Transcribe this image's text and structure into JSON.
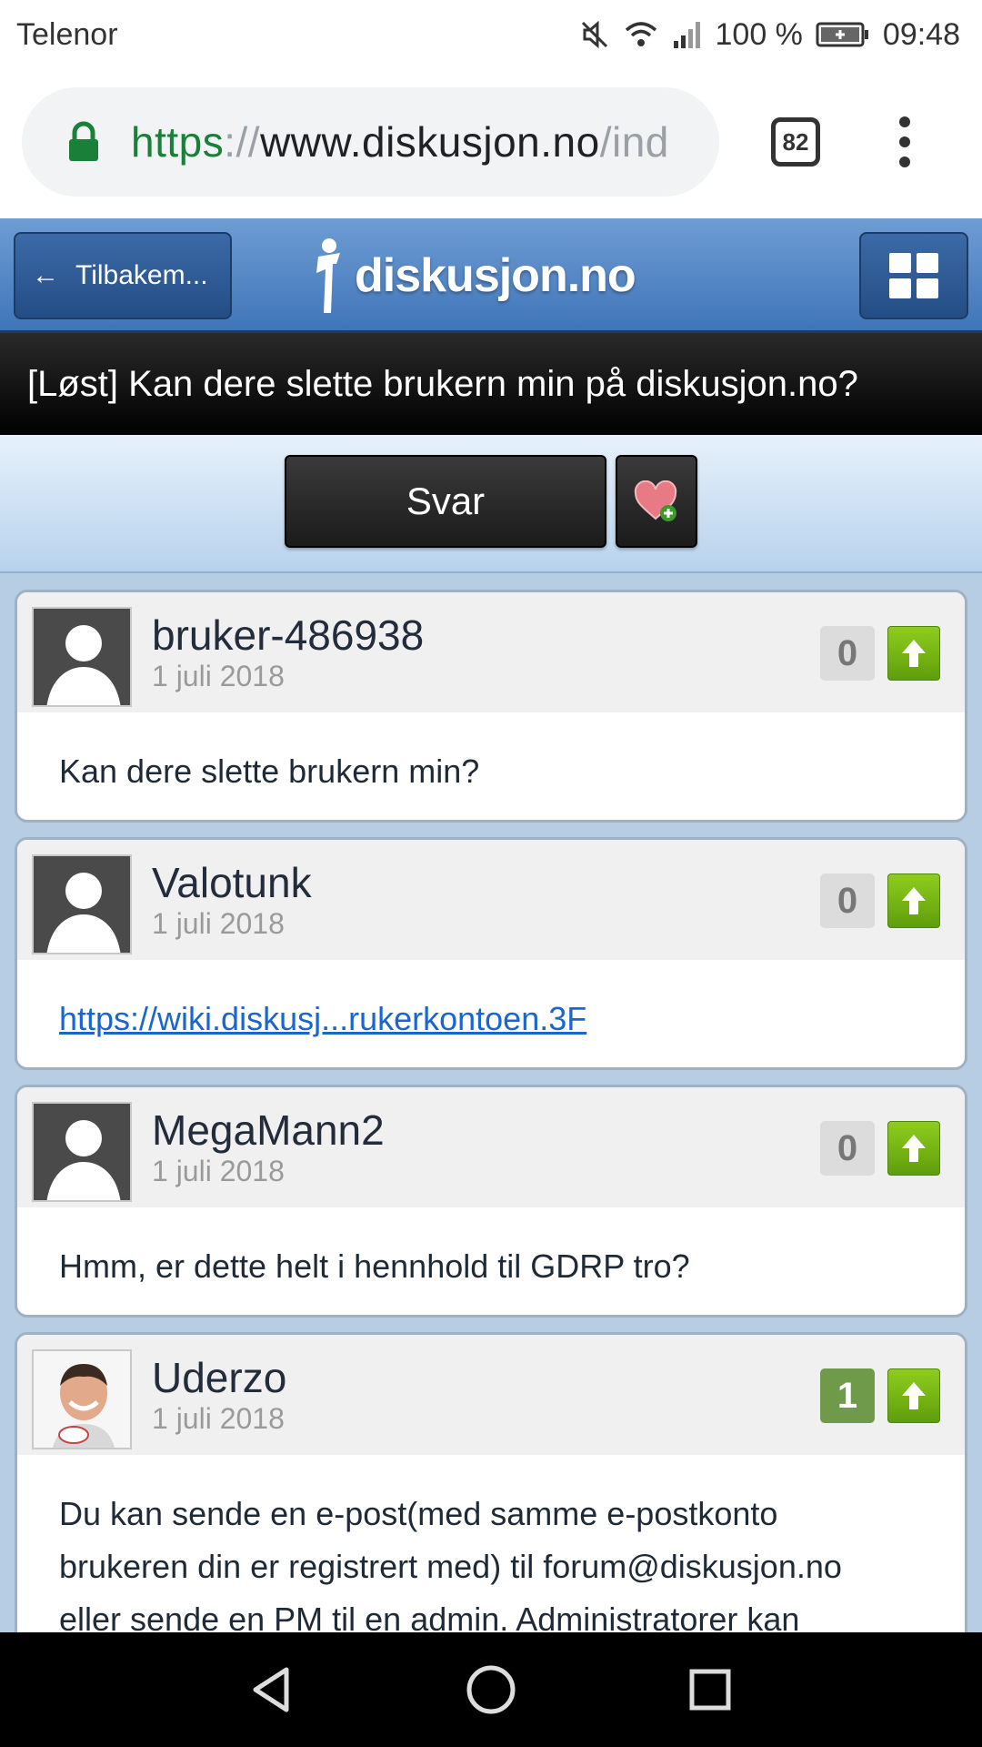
{
  "status_bar": {
    "carrier": "Telenor",
    "battery": "100 %",
    "time": "09:48",
    "icons": [
      "mute-icon",
      "wifi-icon",
      "signal-icon",
      "battery-charging-icon"
    ]
  },
  "browser": {
    "url_scheme": "https",
    "url_sep": "://",
    "url_host": "www.diskusjon.no",
    "url_path": "/ind",
    "tab_count": "82"
  },
  "site_header": {
    "back_label": "Tilbakem...",
    "logo_text": "diskusjon.no"
  },
  "thread": {
    "title": "[Løst] Kan dere slette brukern min på diskusjon.no?",
    "reply_label": "Svar"
  },
  "posts": [
    {
      "username": "bruker-486938",
      "date": "1 juli 2018",
      "votes": "0",
      "body": "Kan dere slette brukern min?"
    },
    {
      "username": "Valotunk",
      "date": "1 juli 2018",
      "votes": "0",
      "link": "https://wiki.diskusj...rukerkontoen.3F"
    },
    {
      "username": "MegaMann2",
      "date": "1 juli 2018",
      "votes": "0",
      "body": "Hmm, er dette helt i hennhold til GDRP tro?"
    },
    {
      "username": "Uderzo",
      "date": "1 juli 2018",
      "votes": "1",
      "body_lines": [
        "Du kan sende en e-post(med samme e-postkonto",
        "brukeren din er registrert med) til forum@diskusjon.no",
        "eller sende en PM til en admin. Administratorer kan"
      ]
    }
  ],
  "colors": {
    "header_blue": "#3f75b8",
    "upvote_green": "#7ab51a",
    "link_blue": "#1a66cc",
    "positive_vote": "#6e9a4a"
  }
}
